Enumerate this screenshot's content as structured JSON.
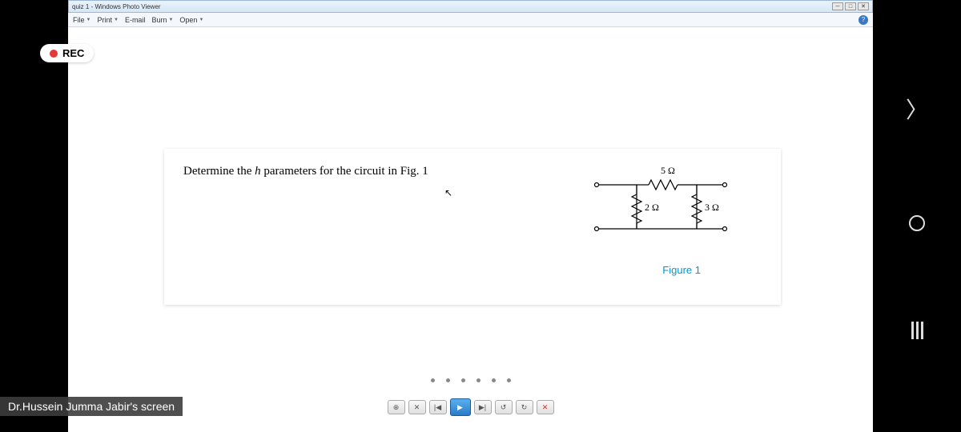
{
  "window": {
    "title": "quiz 1 - Windows Photo Viewer"
  },
  "menu": {
    "file": "File",
    "print": "Print",
    "email": "E-mail",
    "burn": "Burn",
    "open": "Open"
  },
  "rec": {
    "label": "REC"
  },
  "question": {
    "prefix": "Determine the ",
    "param": "h",
    "suffix": " parameters for the circuit in Fig. 1"
  },
  "circuit": {
    "r1": "5 Ω",
    "r2": "2 Ω",
    "r3": "3 Ω",
    "figure": "Figure 1"
  },
  "screen_label": "Dr.Hussein Jumma Jabir's screen",
  "controls": {
    "zoom": "⊕",
    "fit": "✕",
    "prev": "|◀",
    "play": "▶",
    "next": "▶|",
    "ccw": "↺",
    "cw": "↻",
    "delete": "✕"
  }
}
